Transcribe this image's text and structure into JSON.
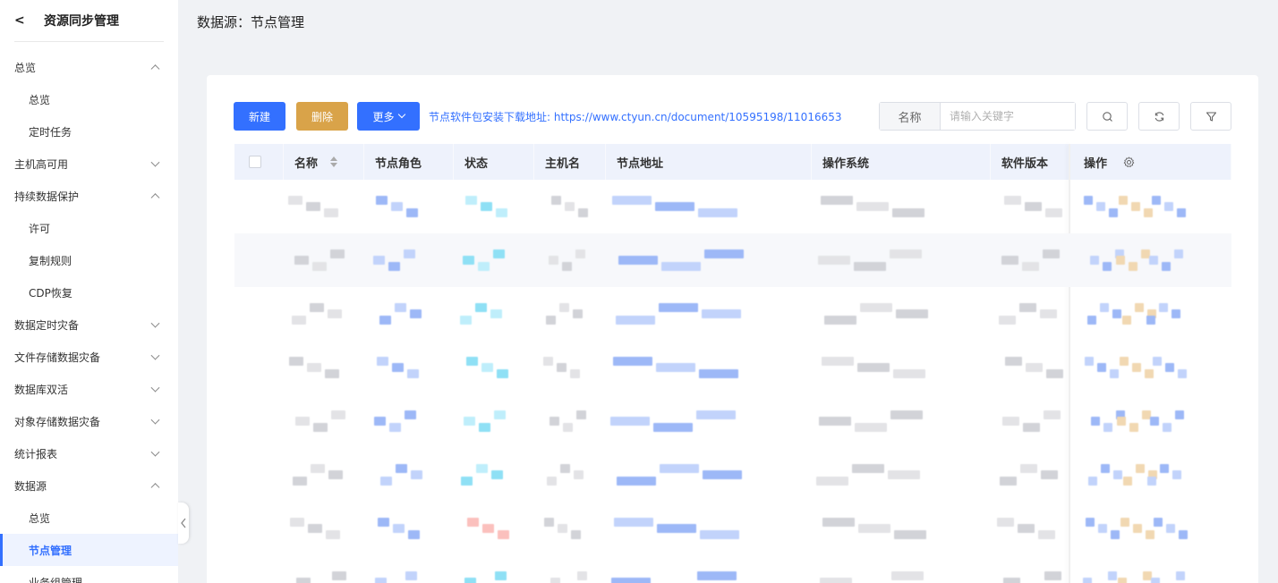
{
  "sidebar": {
    "back": "<",
    "title": "资源同步管理",
    "menu": [
      {
        "label": "总览",
        "type": "group",
        "expanded": true
      },
      {
        "label": "总览",
        "type": "sub"
      },
      {
        "label": "定时任务",
        "type": "sub"
      },
      {
        "label": "主机高可用",
        "type": "group",
        "expanded": false
      },
      {
        "label": "持续数据保护",
        "type": "group",
        "expanded": true
      },
      {
        "label": "许可",
        "type": "sub"
      },
      {
        "label": "复制规则",
        "type": "sub"
      },
      {
        "label": "CDP恢复",
        "type": "sub"
      },
      {
        "label": "数据定时灾备",
        "type": "group",
        "expanded": false
      },
      {
        "label": "文件存储数据灾备",
        "type": "group",
        "expanded": false
      },
      {
        "label": "数据库双活",
        "type": "group",
        "expanded": false
      },
      {
        "label": "对象存储数据灾备",
        "type": "group",
        "expanded": false
      },
      {
        "label": "统计报表",
        "type": "group",
        "expanded": false
      },
      {
        "label": "数据源",
        "type": "group",
        "expanded": true
      },
      {
        "label": "总览",
        "type": "sub"
      },
      {
        "label": "节点管理",
        "type": "sub",
        "active": true
      },
      {
        "label": "业务组管理",
        "type": "sub"
      }
    ]
  },
  "page": {
    "title": "数据源：节点管理"
  },
  "toolbar": {
    "new_label": "新建",
    "delete_label": "删除",
    "more_label": "更多",
    "download_link": "节点软件包安装下载地址: https://www.ctyun.cn/document/10595198/11016653",
    "search_label": "名称",
    "search_placeholder": "请输入关键字"
  },
  "table": {
    "columns": [
      "名称",
      "节点角色",
      "状态",
      "主机名",
      "节点地址",
      "操作系统",
      "软件版本",
      "操作"
    ]
  },
  "colors": {
    "primary": "#3370ff",
    "warning": "#d9a349",
    "header_bg": "#eef2fc"
  }
}
